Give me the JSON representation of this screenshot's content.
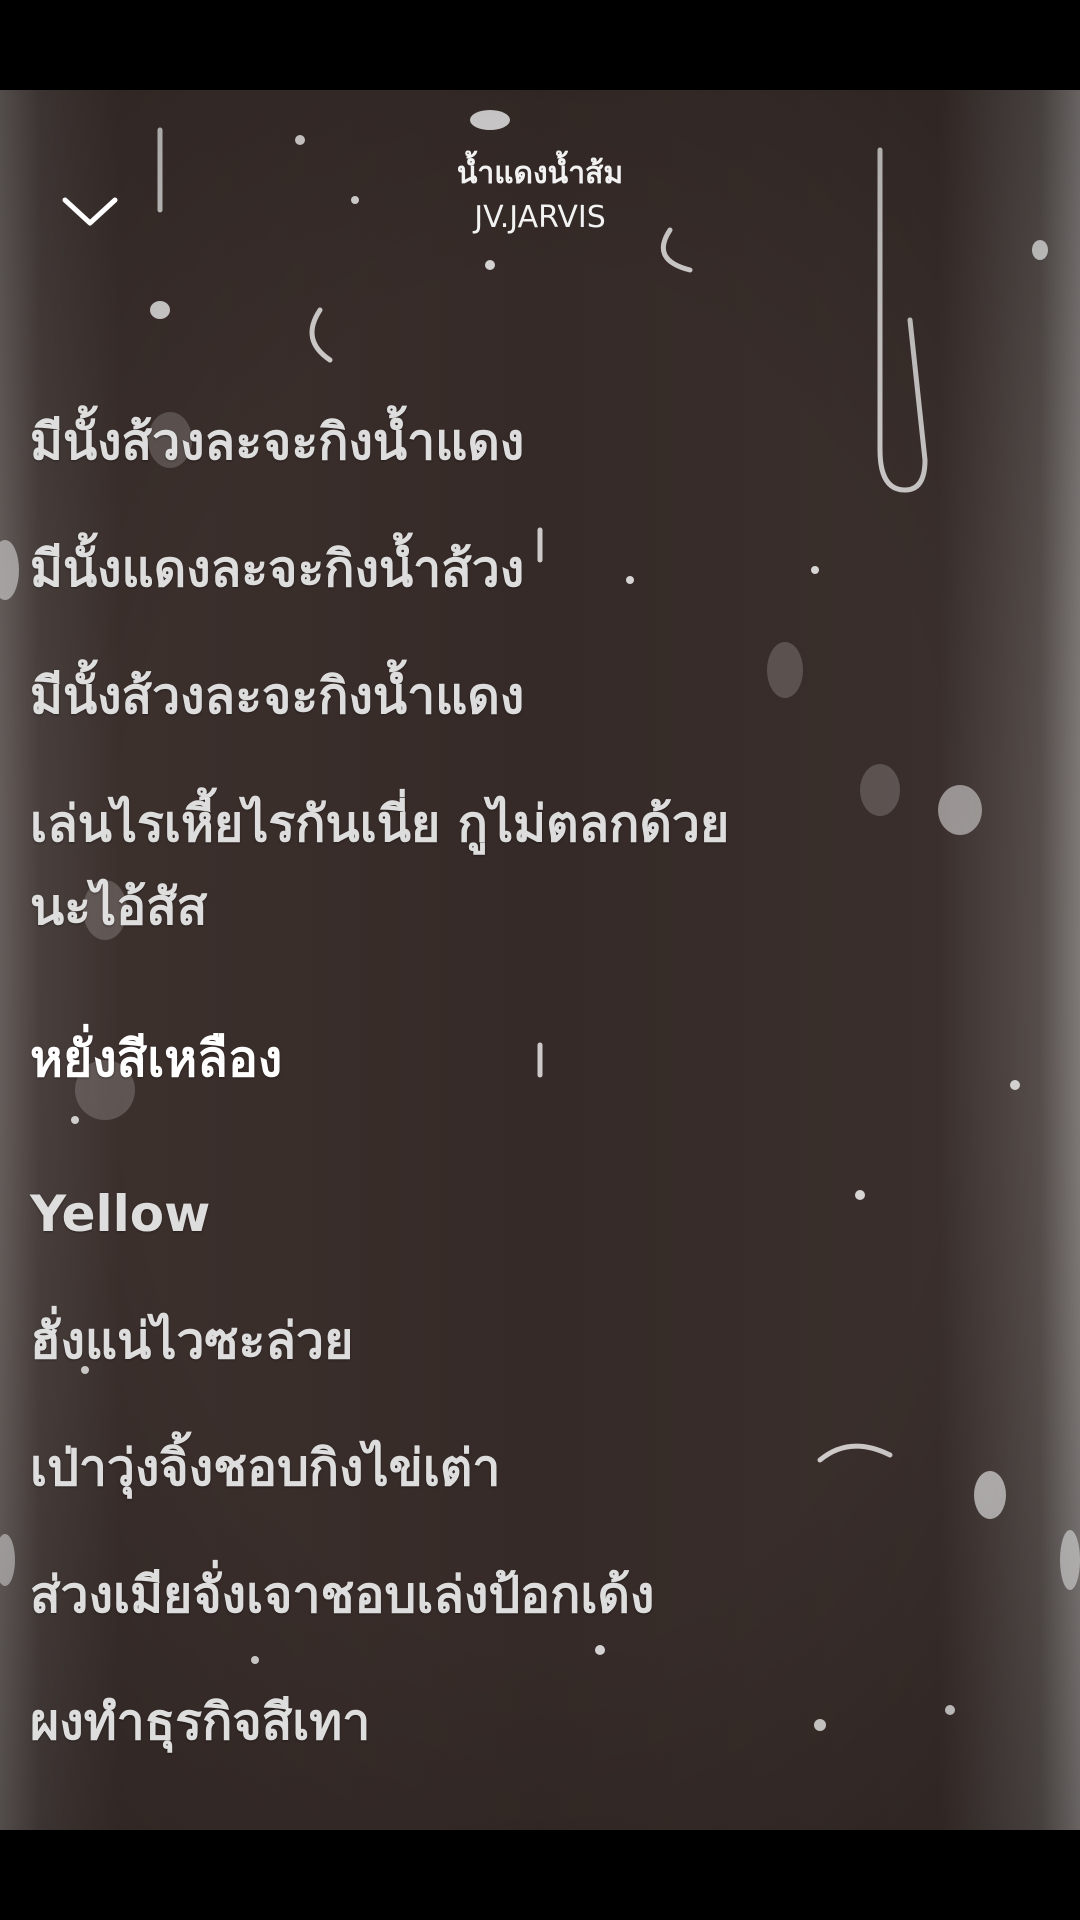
{
  "header": {
    "song_title": "น้ำแดงน้ำส้ม",
    "artist": "JV.JARVIS"
  },
  "lyrics": {
    "lines": [
      "มีนั้งส้วงละจะกิงน้ำแดง",
      "มีนั้งแดงละจะกิงน้ำส้วง",
      "มีนั้งส้วงละจะกิงน้ำแดง",
      "เล่นไรเหี้ยไรกันเนี่ย กูไม่ตลกด้วย",
      "นะไอ้สัส",
      "หยั่งสีเหลือง",
      "Yellow",
      "ฮั่งแน่ไวซะล่วย",
      "เป่าวุ่งจิ้งชอบกิงไข่เต่า",
      "ส่วงเมียจั่งเจาชอบเล่งป้อกเด้ง",
      "ผงทำธุรกิจสีเทา"
    ],
    "active_index": 5
  },
  "icons": {
    "collapse": "chevron-down-icon"
  },
  "colors": {
    "text": "#ffffff",
    "background": "#3a2e2b"
  }
}
